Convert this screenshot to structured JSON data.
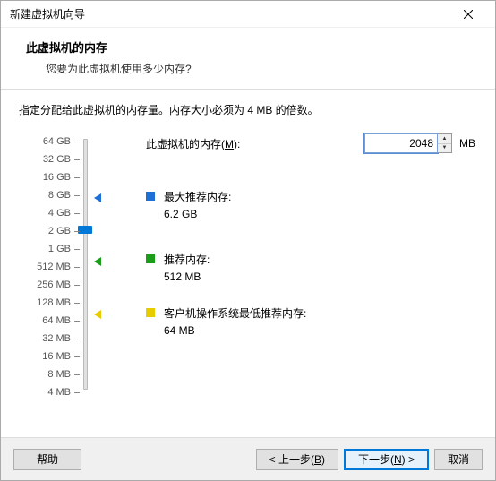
{
  "window": {
    "title": "新建虚拟机向导"
  },
  "header": {
    "title": "此虚拟机的内存",
    "subtitle": "您要为此虚拟机使用多少内存?"
  },
  "instruction": "指定分配给此虚拟机的内存量。内存大小必须为 4 MB 的倍数。",
  "memory": {
    "label_prefix": "此虚拟机的内存(",
    "label_mnemonic": "M",
    "label_suffix": "):",
    "value": "2048",
    "unit": "MB"
  },
  "scale": [
    "64 GB",
    "32 GB",
    "16 GB",
    "8 GB",
    "4 GB",
    "2 GB",
    "1 GB",
    "512 MB",
    "256 MB",
    "128 MB",
    "64 MB",
    "32 MB",
    "16 MB",
    "8 MB",
    "4 MB"
  ],
  "recommendations": {
    "max": {
      "label": "最大推荐内存:",
      "value": "6.2 GB",
      "color": "#1e6fd6"
    },
    "rec": {
      "label": "推荐内存:",
      "value": "512 MB",
      "color": "#1a9e1a"
    },
    "min": {
      "label": "客户机操作系统最低推荐内存:",
      "value": "64 MB",
      "color": "#e6cc00"
    }
  },
  "footer": {
    "help": "帮助",
    "back_prefix": "< 上一步(",
    "back_mn": "B",
    "back_suffix": ")",
    "next_prefix": "下一步(",
    "next_mn": "N",
    "next_suffix": ") >",
    "cancel": "取消"
  }
}
